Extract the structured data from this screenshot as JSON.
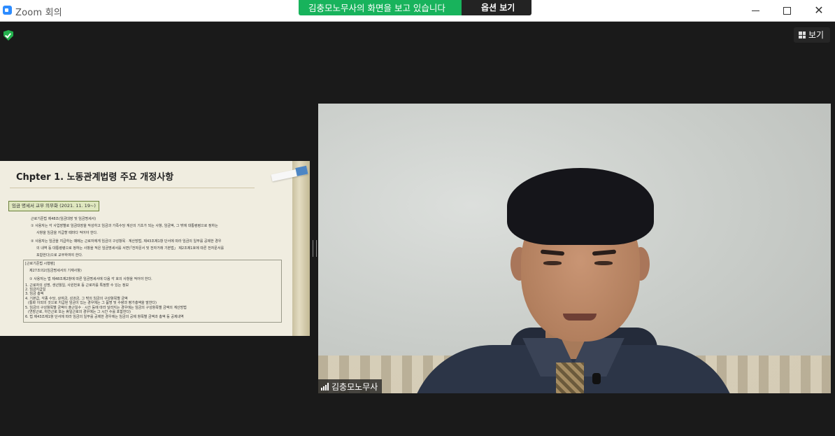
{
  "window": {
    "title": "Zoom 회의",
    "share_banner": "김충모노무사의 화면을 보고 있습니다",
    "view_options": "옵션 보기",
    "icons": [
      "zoom-logo-icon",
      "minimize-icon",
      "maximize-icon",
      "close-icon"
    ]
  },
  "meeting": {
    "view_button": "보기",
    "encryption_icon": "shield-check-icon",
    "participant_name": "김충모노무사"
  },
  "slide": {
    "title": "Chpter 1. 노동관계법령 주요 개정사항",
    "tag": "임금 명세서 교부 의무화 (2021. 11. 19~)",
    "lines": [
      "근로기준법 제48조(임금대장 및 임금명세서)",
      "① 사용자는 각 사업장별로 임금대장을 작성하고 임금과 가족수당 계산의 기초가 되는 사항, 임금액, 그 밖에 대통령령으로 정하는",
      "사항을 임금을 지급할 때마다 적어야 한다.",
      "② 사용자는 임금을 지급하는 때에는 근로자에게 임금의 구성항목ㆍ계산방법, 제43조제1항 단서에 따라 임금의 일부를 공제한 경우",
      "의 내역 등 대통령령으로 정하는 사항을 적은 임금명세서를 서면(「전자문서 및 전자거래 기본법」 제2조제1호에 따른 전자문서를",
      "포함한다)으로 교부하여야 한다."
    ],
    "box_lines": [
      "[근로기준법 시행령]",
      "제27조의2(임금명세서의 기재사항)",
      "① 사용자는 법 제48조제2항에 따른 임금명세서에 다음 각 호의 사항을 적어야 한다.",
      "1. 근로자의 성명, 생년월일, 사원번호 등 근로자를 특정할 수 있는 정보",
      "2. 임금지급일",
      "3. 임금 총액",
      "4. 기본급, 각종 수당, 상여금, 성과금, 그 밖의 임금의 구성항목별 금액",
      "(통화 이외의 것으로 지급된 임금이 있는 경우에는 그 품명 및 수량과 평가총액을 말한다)",
      "5. 임금의 구성항목별 금액이 출근일수ㆍ시간 등에 따라 달라지는 경우에는 임금의 구성항목별 금액의 계산방법",
      "(연장근로, 야간근로 또는 휴일근로의 경우에는 그 시간 수를 포함한다)",
      "6. 법 제43조제1항 단서에 따라 임금의 일부를 공제한 경우에는 임금의 공제 항목별 금액과 총액 등 공제내역"
    ]
  }
}
